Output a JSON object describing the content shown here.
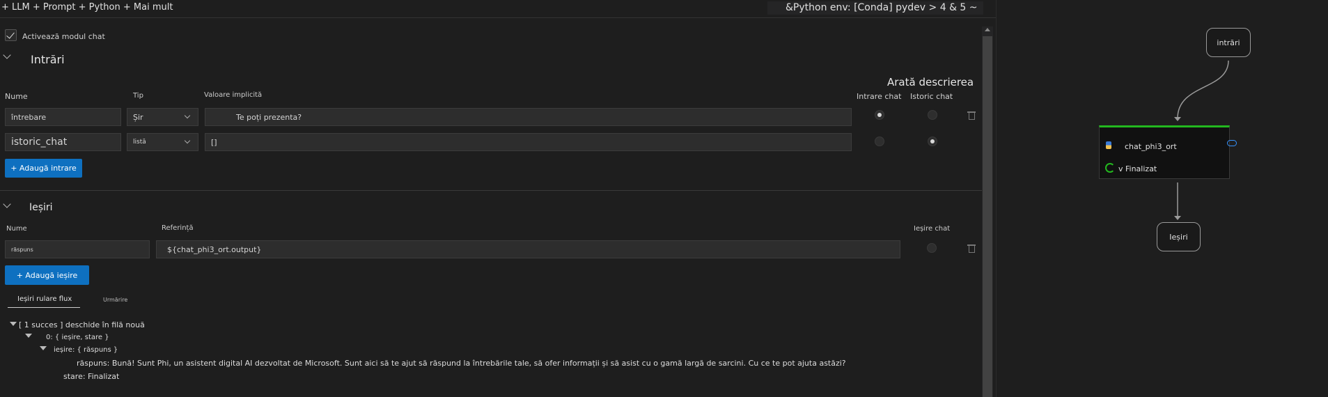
{
  "toolbar": {
    "menu_label": "+ LLM + Prompt + Python + Mai mult",
    "env_label": "&Python env: [Conda] pydev > 4 & 5 ~"
  },
  "chat_mode": {
    "label": "Activează modul chat",
    "checked": true
  },
  "inputs": {
    "title": "Intrări",
    "show_description_label": "Arată descrierea",
    "headers": {
      "name": "Nume",
      "type": "Tip",
      "default": "Valoare implicită",
      "chat_input": "Intrare chat",
      "chat_history": "Istoric chat"
    },
    "rows": [
      {
        "name": "întrebare",
        "type": "Șir",
        "default": "Te poți prezenta?",
        "chat_input": true,
        "chat_history": false
      },
      {
        "name": "istoric_chat",
        "type": "listă",
        "default": "[]",
        "chat_input": false,
        "chat_history": true
      }
    ],
    "add_label": "+ Adaugă intrare"
  },
  "outputs": {
    "title": "Ieșiri",
    "headers": {
      "name": "Nume",
      "reference": "Referință",
      "chat_output": "Ieșire chat"
    },
    "rows": [
      {
        "name": "răspuns",
        "reference": "${chat_phi3_ort.output}",
        "chat_output": false
      }
    ],
    "add_label": "+ Adaugă ieșire"
  },
  "run_tabs": [
    {
      "label": "Ieșiri rulare flux",
      "active": true
    },
    {
      "label": "Urmărire",
      "active": false
    }
  ],
  "run_tree": {
    "root": "[ 1 succes ] deschide în filă nouă",
    "item0": "0: { ieșire, stare }",
    "output_node": "ieșire: { răspuns }",
    "answer": "răspuns: Bună! Sunt Phi, un asistent digital AI dezvoltat de Microsoft. Sunt aici să te ajut să răspund la întrebările tale, să ofer informații și să asist cu o gamă largă de sarcini. Cu ce te pot ajuta astăzi?",
    "status": "stare: Finalizat"
  },
  "graph": {
    "inputs_node": "intrări",
    "llm_node": {
      "name": "chat_phi3_ort",
      "status": "v Finalizat",
      "status_color": "#23b81f"
    },
    "outputs_node": "Ieșiri"
  },
  "colors": {
    "accent": "#0e70c0",
    "success": "#23b81f"
  }
}
